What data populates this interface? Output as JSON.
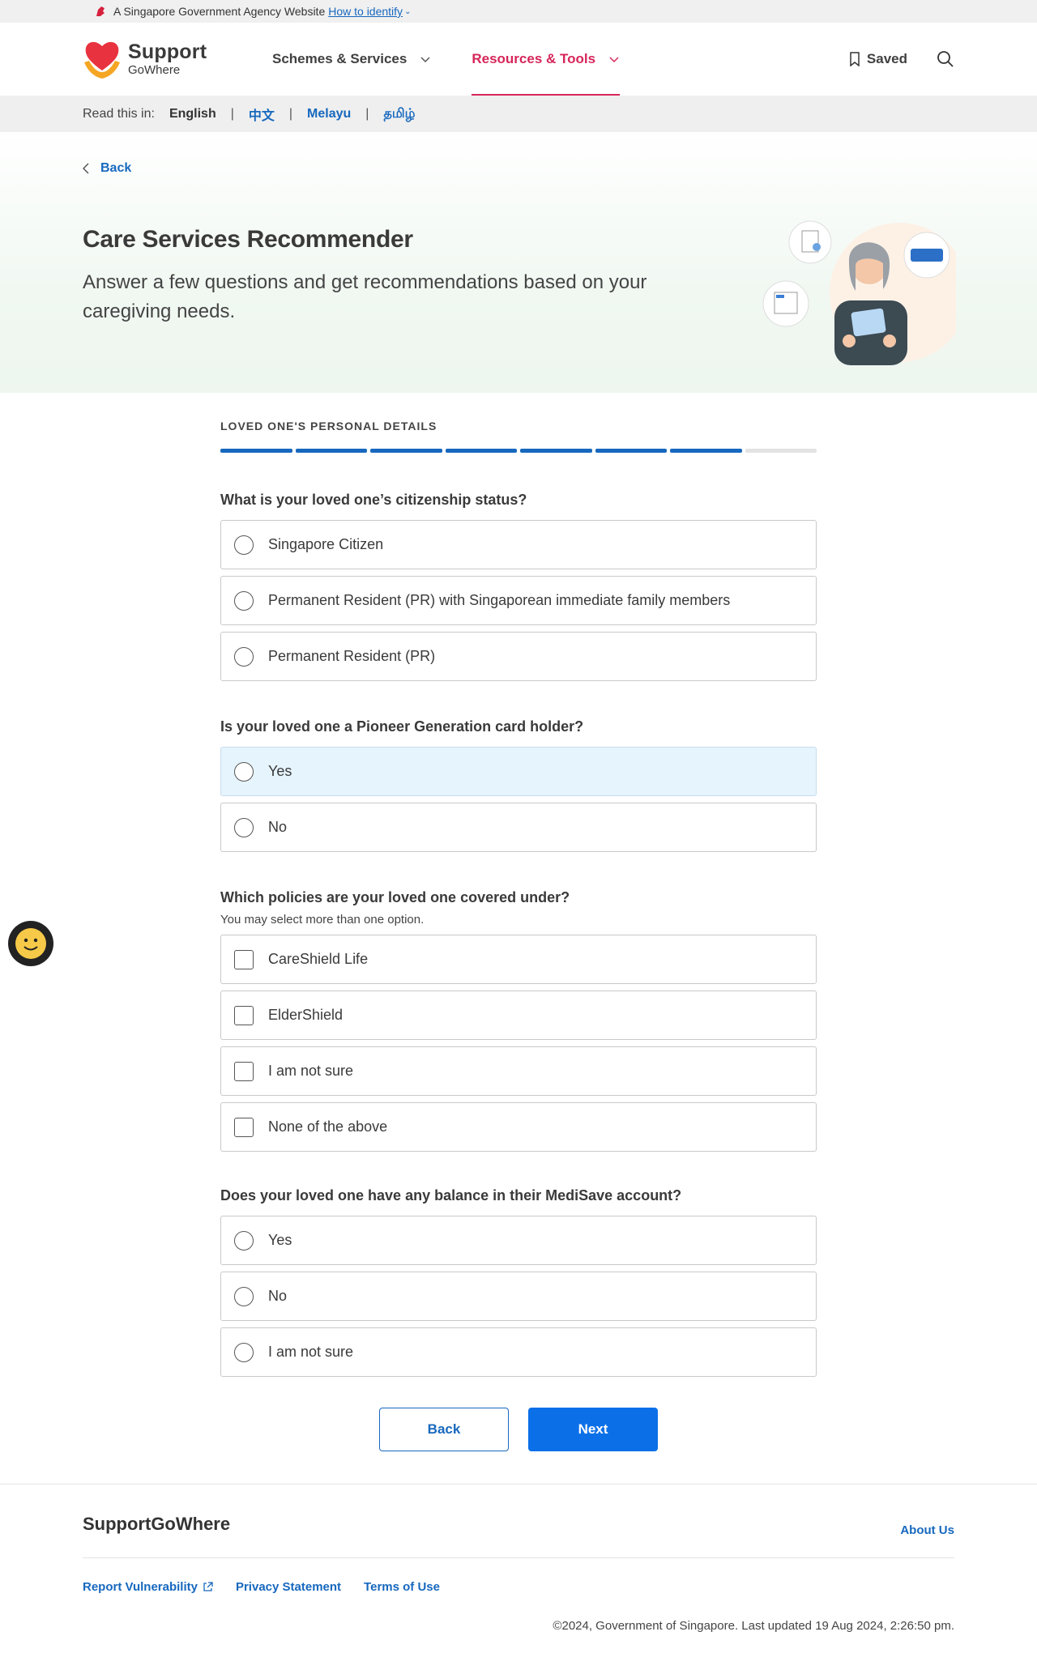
{
  "masthead": {
    "text": "A Singapore Government Agency Website",
    "link": "How to identify"
  },
  "logo": {
    "line1": "Support",
    "line2": "GoWhere"
  },
  "nav": {
    "items": [
      {
        "label": "Schemes & Services",
        "active": false
      },
      {
        "label": "Resources & Tools",
        "active": true
      }
    ],
    "saved_label": "Saved"
  },
  "lang": {
    "label": "Read this in:",
    "options": [
      "English",
      "中文",
      "Melayu",
      "தமிழ்"
    ],
    "current": "English"
  },
  "hero": {
    "back": "Back",
    "title": "Care Services Recommender",
    "subtitle": "Answer a few questions and get recommendations based on your caregiving needs."
  },
  "form": {
    "section_title": "LOVED ONE'S PERSONAL DETAILS",
    "progress": {
      "completed": 7,
      "total": 8
    },
    "questions": [
      {
        "label": "What is your loved one’s citizenship status?",
        "type": "radio",
        "options": [
          "Singapore Citizen",
          "Permanent Resident (PR) with Singaporean immediate family members",
          "Permanent Resident (PR)"
        ]
      },
      {
        "label": "Is your loved one a Pioneer Generation card holder?",
        "type": "radio",
        "options": [
          "Yes",
          "No"
        ]
      },
      {
        "label": "Which policies are your loved one covered under?",
        "hint": "You may select more than one option.",
        "type": "checkbox",
        "options": [
          "CareShield Life",
          "ElderShield",
          "I am not sure",
          "None of the above"
        ]
      },
      {
        "label": "Does your loved one have any balance in their MediSave account?",
        "type": "radio",
        "options": [
          "Yes",
          "No",
          "I am not sure"
        ]
      }
    ],
    "back_button": "Back",
    "next_button": "Next"
  },
  "footer": {
    "brand": "SupportGoWhere",
    "about": "About Us",
    "links": [
      "Report Vulnerability",
      "Privacy Statement",
      "Terms of Use"
    ],
    "copyright": "©2024, Government of Singapore. Last updated 19 Aug 2024, 2:26:50 pm."
  },
  "colors": {
    "primary": "#0b70e8",
    "link": "#1768be",
    "active_nav": "#d6265a",
    "highlight": "#e6f4fd"
  },
  "icons": [
    "lion-icon",
    "chevron-down-icon",
    "bookmark-icon",
    "search-icon",
    "chevron-left-icon",
    "external-link-icon",
    "smiley-icon"
  ]
}
